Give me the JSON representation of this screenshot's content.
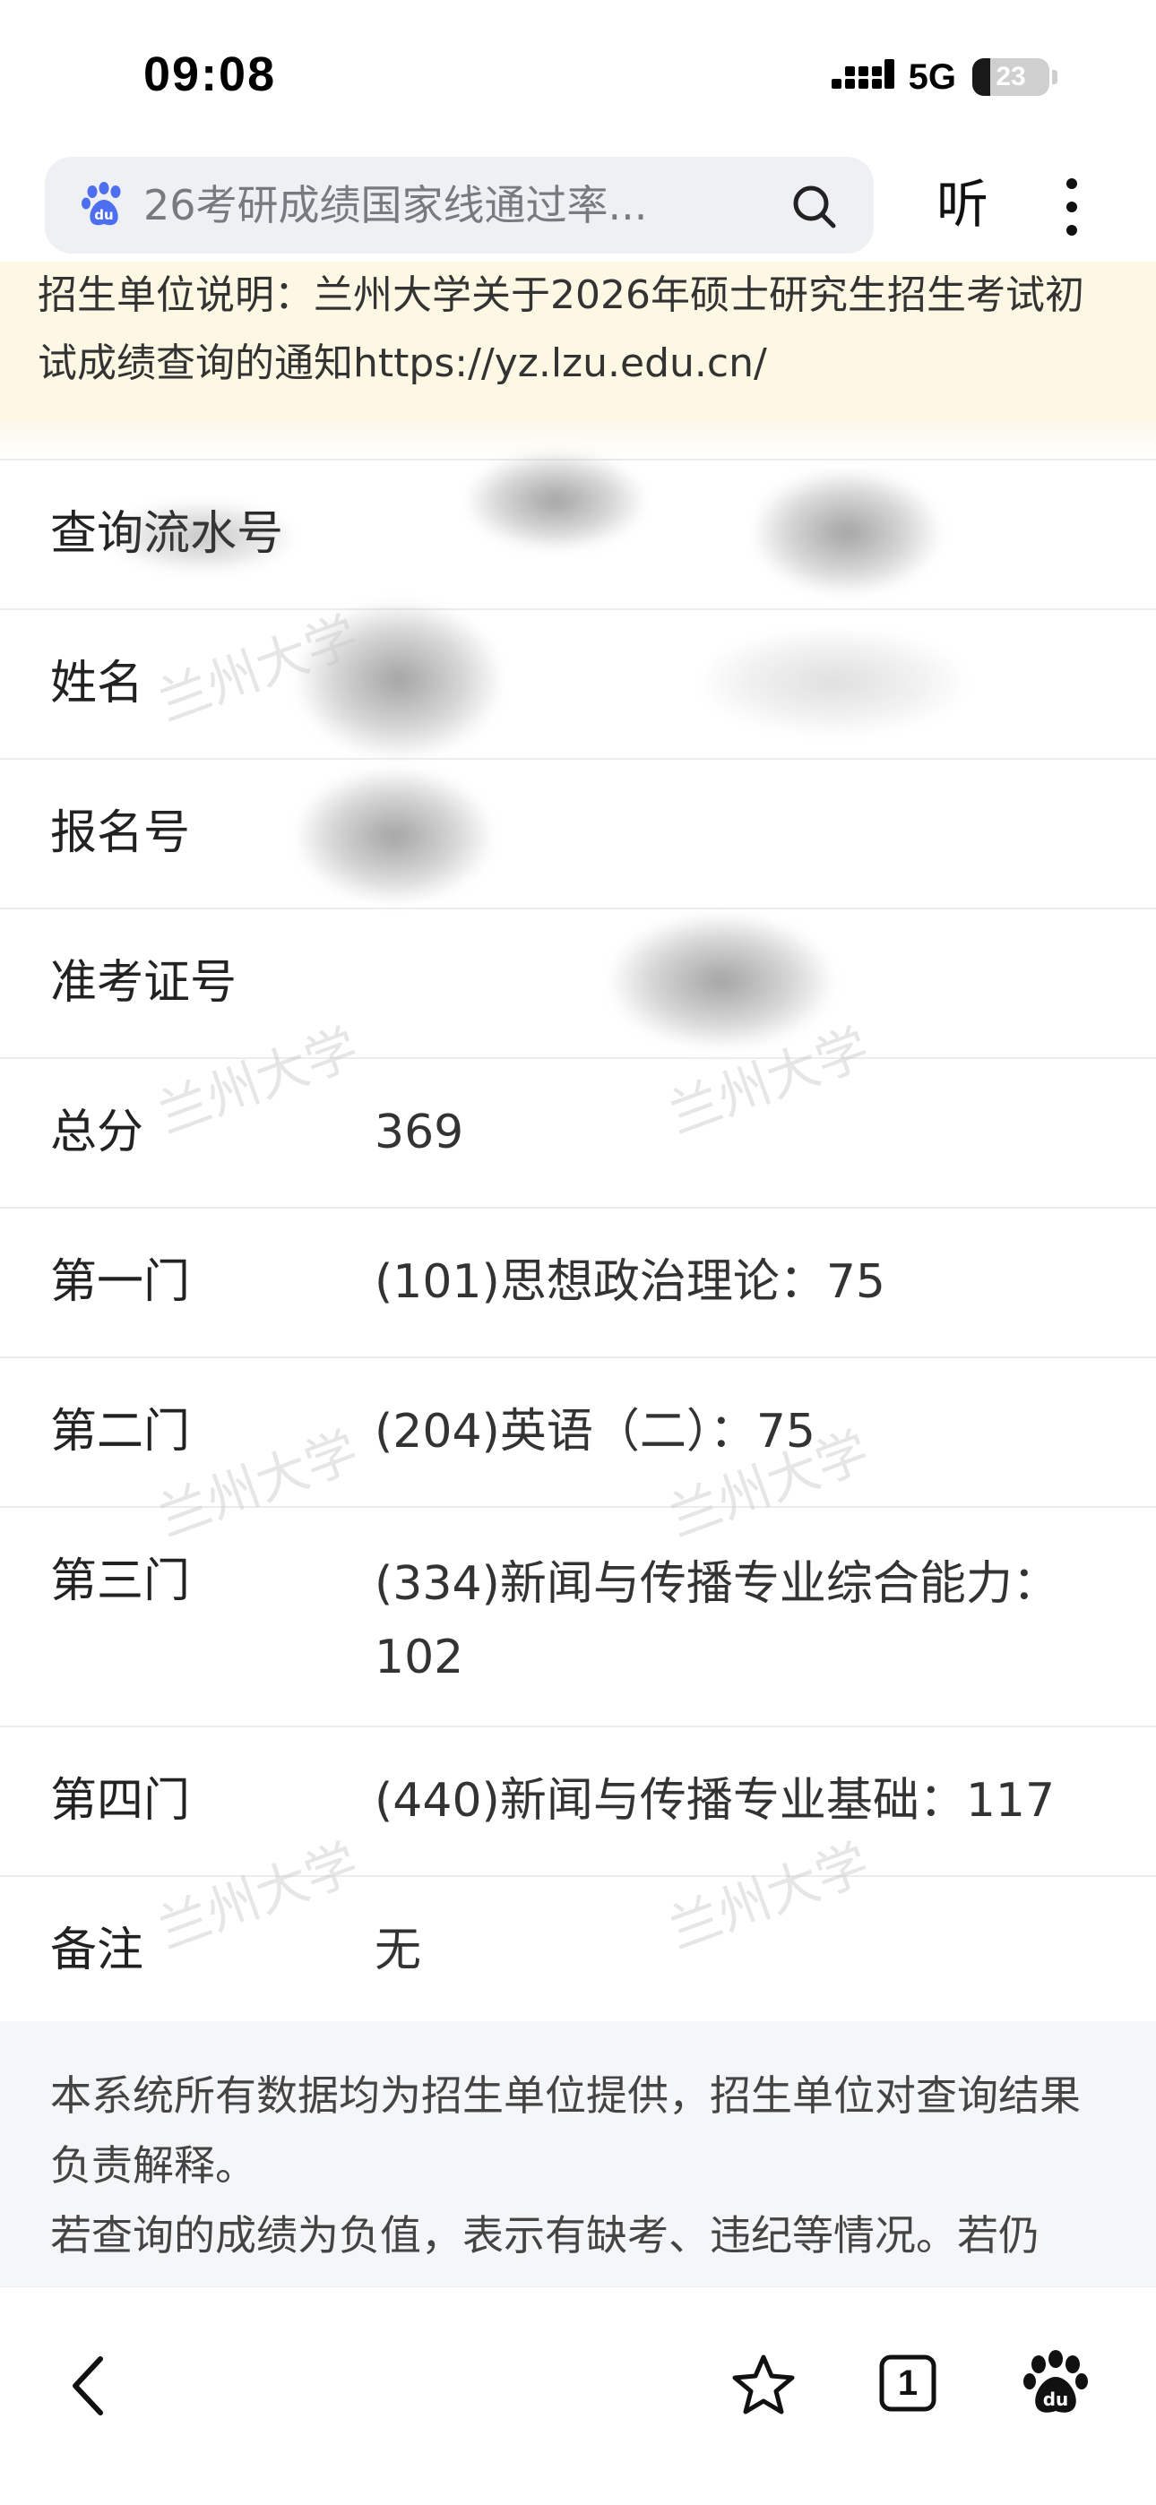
{
  "status_bar": {
    "time": "09:08",
    "network": "5G",
    "battery": "23",
    "battery_fraction": 0.23
  },
  "search": {
    "query": "26考研成绩国家线通过率...",
    "logo_icon": "baidu-logo-icon",
    "search_icon": "search-icon",
    "listen_label": "听",
    "more_icon": "more-vertical-icon"
  },
  "notice": {
    "text": "招生单位说明：兰州大学关于2026年硕士研究生招生考试初试成绩查询的通知https://yz.lzu.edu.cn/"
  },
  "watermark": "兰州大学",
  "results": {
    "rows": [
      {
        "label": "查询流水号",
        "value": ""
      },
      {
        "label": "姓名",
        "value": ""
      },
      {
        "label": "报名号",
        "value": ""
      },
      {
        "label": "准考证号",
        "value": ""
      },
      {
        "label": "总分",
        "value": "369"
      },
      {
        "label": "第一门",
        "value": "(101)思想政治理论：75"
      },
      {
        "label": "第二门",
        "value": "(204)英语（二）：75"
      },
      {
        "label": "第三门",
        "value": "(334)新闻与传播专业综合能力：102"
      },
      {
        "label": "第四门",
        "value": "(440)新闻与传播专业基础：117"
      },
      {
        "label": "备注",
        "value": "无"
      }
    ]
  },
  "footer": {
    "line1": "本系统所有数据均为招生单位提供，招生单位对查询结果负责解释。",
    "line2": "若查询的成绩为负值，表示有缺考、违纪等情况。若仍"
  },
  "bottom_bar": {
    "tab_count": "1",
    "icons": [
      "back-icon",
      "star-icon",
      "tabs-icon",
      "baidu-paw-icon"
    ]
  },
  "colors": {
    "notice_bg": "#fdf8e4",
    "footer_bg": "#f5f6f8",
    "baidu_blue": "#4e6ef2"
  }
}
